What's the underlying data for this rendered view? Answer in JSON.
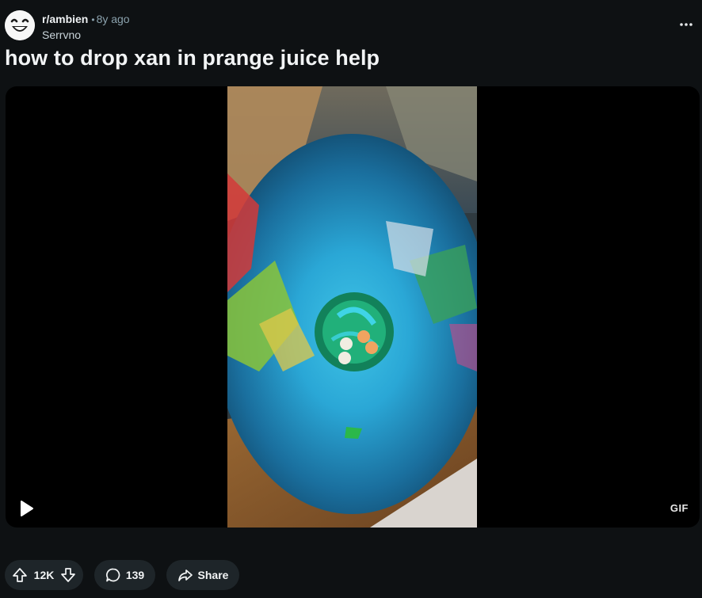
{
  "post": {
    "subreddit": "r/ambien",
    "separator": "•",
    "age": "8y ago",
    "author": "Serrvno",
    "title": "how to drop xan in prange juice help"
  },
  "media": {
    "badge": "GIF",
    "frame_colors": {
      "cup_blue": "#1f7fb8",
      "table_wood": "#8a5a2a",
      "label_green": "#1ea34a"
    }
  },
  "actions": {
    "vote_count": "12K",
    "comment_count": "139",
    "share_label": "Share"
  },
  "icons": {
    "avatar": "snoo-smiling-avatar-icon",
    "more": "ellipsis-horizontal-icon",
    "play": "play-icon",
    "upvote": "upvote-arrow-icon",
    "downvote": "downvote-arrow-icon",
    "comment": "comment-bubble-icon",
    "share": "share-arrow-icon"
  },
  "colors": {
    "background": "#0e1113",
    "pill": "#1e2529",
    "muted_text": "#8ba2ad"
  }
}
